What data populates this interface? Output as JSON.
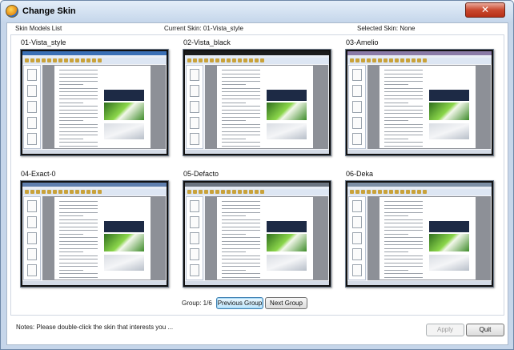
{
  "window": {
    "title": "Change Skin",
    "close_glyph": "✕"
  },
  "header": {
    "list_label": "Skin Models List",
    "current_skin": "Current Skin:  01-Vista_style",
    "selected_skin": "Selected Skin: None"
  },
  "skins": [
    {
      "name": "01-Vista_style",
      "theme": "#3a6fb5"
    },
    {
      "name": "02-Vista_black",
      "theme": "#1b1b1b"
    },
    {
      "name": "03-Amelio",
      "theme": "#8a7aa6"
    },
    {
      "name": "04-Exact-0",
      "theme": "#5f7fae"
    },
    {
      "name": "05-Defacto",
      "theme": "#6b7480"
    },
    {
      "name": "06-Deka",
      "theme": "#7d8fa5"
    }
  ],
  "pager": {
    "group_label": "Group:  1/6",
    "prev_label": "Previous Group",
    "next_label": "Next Group"
  },
  "footer": {
    "notes": "Notes:  Please double-click the skin  that interests you ...",
    "apply_label": "Apply",
    "quit_label": "Quit"
  }
}
